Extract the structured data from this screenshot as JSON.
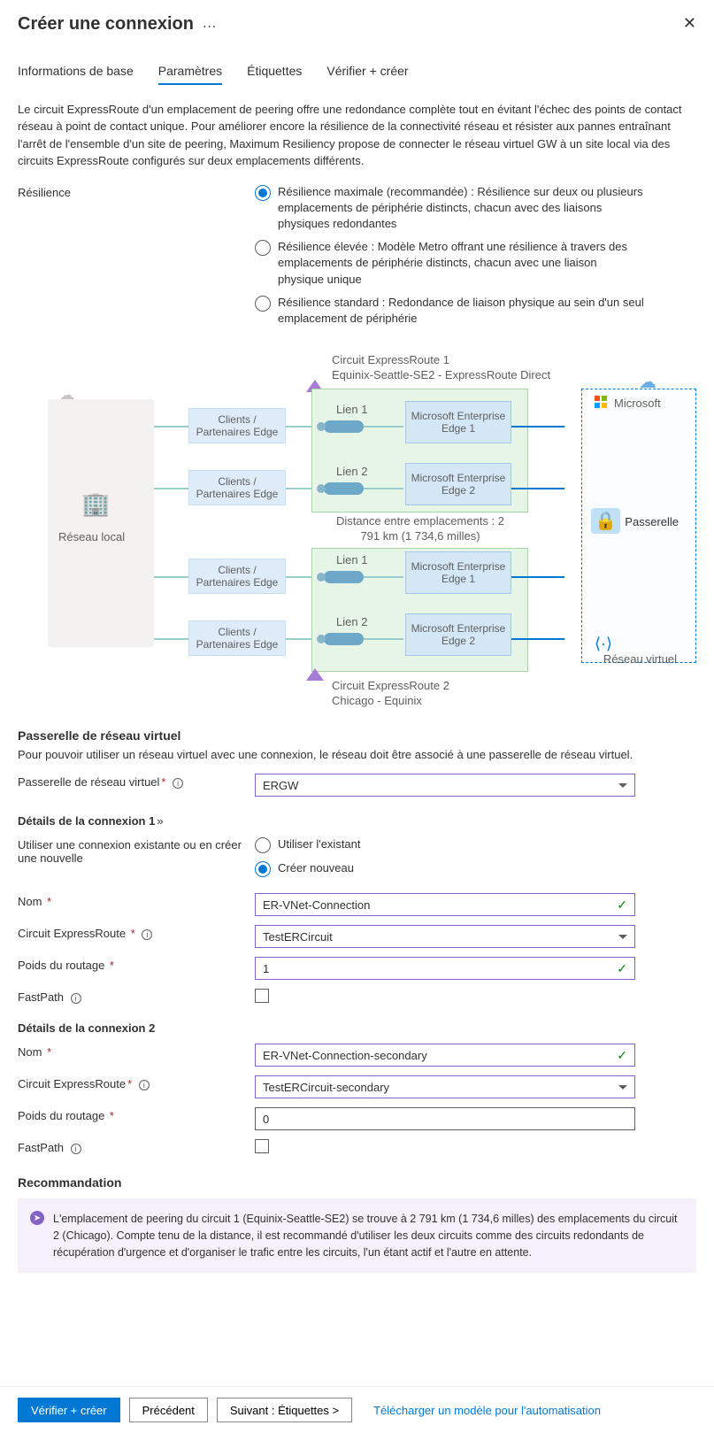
{
  "header": {
    "title": "Créer une connexion"
  },
  "tabs": [
    "Informations de base",
    "Paramètres",
    "Étiquettes",
    "Vérifier + créer"
  ],
  "active_tab": 1,
  "intro": "Le circuit ExpressRoute d'un emplacement de peering offre une redondance complète tout en évitant l'échec des points de contact réseau à point de contact unique. Pour améliorer encore la résilience de la connectivité réseau et résister aux pannes entraînant l'arrêt de l'ensemble d'un site de peering, Maximum Resiliency propose de connecter le réseau virtuel GW à un site local via des circuits ExpressRoute configurés sur deux emplacements différents.",
  "resilience": {
    "label": "Résilience",
    "options": [
      "Résilience maximale (recommandée) : Résilience sur deux ou plusieurs emplacements de périphérie distincts, chacun avec des liaisons physiques redondantes",
      "Résilience élevée : Modèle Metro offrant une résilience à travers des emplacements de périphérie distincts, chacun avec une liaison physique unique",
      "Résilience standard : Redondance de liaison physique au sein d'un seul emplacement de périphérie"
    ],
    "selected": 0
  },
  "diagram": {
    "circuit1_t1": "Circuit ExpressRoute 1",
    "circuit1_t2": "Equinix-Seattle-SE2 - ExpressRoute Direct",
    "circuit2_t1": "Circuit ExpressRoute 2",
    "circuit2_t2": "Chicago - Equinix",
    "onprem": "Réseau local",
    "client": "Clients / Partenaires Edge",
    "link1": "Lien 1",
    "link2": "Lien 2",
    "msee1": "Microsoft Enterprise Edge 1",
    "msee2": "Microsoft Enterprise Edge 2",
    "distance1": "Distance entre emplacements : 2",
    "distance2": "791 km (1 734,6 milles)",
    "microsoft": "Microsoft",
    "gateway": "Passerelle",
    "vnet": "Réseau virtuel"
  },
  "vnet_gw": {
    "section": "Passerelle de réseau virtuel",
    "desc": "Pour pouvoir utiliser un réseau virtuel avec une connexion, le réseau doit être associé à une passerelle de réseau virtuel.",
    "label": "Passerelle de réseau virtuel",
    "value": "ERGW"
  },
  "conn1": {
    "heading": "Détails de la connexion 1",
    "use_label": "Utiliser une connexion existante ou en créer une nouvelle",
    "opt_existing": "Utiliser l'existant",
    "opt_new": "Créer nouveau",
    "name_label": "Nom",
    "name_value": "ER-VNet-Connection",
    "circuit_label": "Circuit ExpressRoute",
    "circuit_value": "TestERCircuit",
    "weight_label": "Poids du routage",
    "weight_value": "1",
    "fastpath_label": "FastPath"
  },
  "conn2": {
    "heading": "Détails de la connexion 2",
    "name_label": "Nom",
    "name_value": "ER-VNet-Connection-secondary",
    "circuit_label": "Circuit ExpressRoute",
    "circuit_value": "TestERCircuit-secondary",
    "weight_label": "Poids du routage",
    "weight_value": "0",
    "fastpath_label": "FastPath"
  },
  "recommendation": {
    "heading": "Recommandation",
    "text": "L'emplacement de peering du circuit 1 (Equinix-Seattle-SE2) se trouve à 2 791 km (1 734,6 milles) des emplacements du circuit 2 (Chicago). Compte tenu de la distance, il est recommandé d'utiliser les deux circuits comme des circuits redondants de récupération d'urgence et d'organiser le trafic entre les circuits, l'un étant actif et l'autre en attente."
  },
  "footer": {
    "review": "Vérifier + créer",
    "previous": "Précédent",
    "next": "Suivant : Étiquettes >",
    "download": "Télécharger un modèle pour l'automatisation"
  }
}
